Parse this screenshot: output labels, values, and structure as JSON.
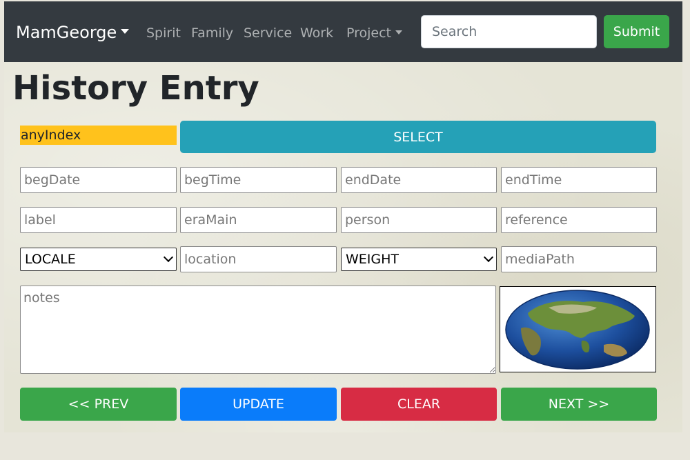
{
  "navbar": {
    "brand": "MamGeorge",
    "links": [
      "Spirit",
      "Family",
      "Service",
      "Work"
    ],
    "project_label": "Project",
    "search_placeholder": "Search",
    "submit_label": "Submit"
  },
  "page": {
    "title": "History Entry"
  },
  "index": {
    "label": "anyIndex",
    "select_label": "SELECT"
  },
  "fields": {
    "begDate": "begDate",
    "begTime": "begTime",
    "endDate": "endDate",
    "endTime": "endTime",
    "label": "label",
    "eraMain": "eraMain",
    "person": "person",
    "reference": "reference",
    "location": "location",
    "mediaPath": "mediaPath",
    "notes": "notes"
  },
  "selects": {
    "locale": "LOCALE",
    "weight": "WEIGHT"
  },
  "buttons": {
    "prev": "<< PREV",
    "update": "UPDATE",
    "clear": "CLEAR",
    "next": "NEXT >>"
  },
  "colors": {
    "navbar": "#343a40",
    "submit": "#3aa64a",
    "anyIndex": "#ffc21c",
    "select": "#25a1b7",
    "prev_next": "#3aa64a",
    "update": "#0a7cfa",
    "clear": "#d72c44"
  },
  "icons": {
    "media_preview": "globe-image"
  }
}
